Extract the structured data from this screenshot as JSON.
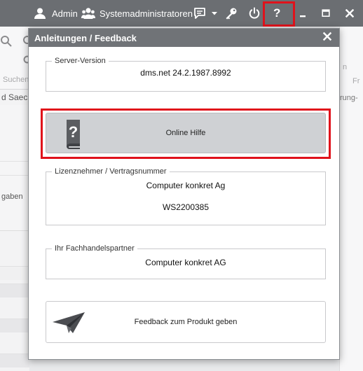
{
  "topbar": {
    "user_name": "Admin",
    "group_name": "Systemadministratoren",
    "help_glyph": "?",
    "icons": [
      "user-icon",
      "group-icon",
      "chat-icon",
      "dropdown-icon",
      "key-icon",
      "power-icon",
      "help-icon",
      "minimize-icon",
      "maximize-icon",
      "close-icon"
    ],
    "highlight_color": "#e0121b"
  },
  "background": {
    "ribbon_search_label": "Suchen",
    "path_text": "d Saeck",
    "row_text": "gaben",
    "right_text_1": "n",
    "right_text_2": "Fr",
    "right_text_3": "rung-"
  },
  "dialog": {
    "title": "Anleitungen / Feedback",
    "server": {
      "legend": "Server-Version",
      "value": "dms.net 24.2.1987.8992"
    },
    "online_help": {
      "label": "Online Hilfe",
      "icon": "help-book-icon"
    },
    "licensee": {
      "legend": "Lizenznehmer / Vertragsnummer",
      "company": "Computer konkret Ag",
      "contract": "WS2200385"
    },
    "partner": {
      "legend": "Ihr Fachhandelspartner",
      "value": "Computer konkret AG"
    },
    "feedback": {
      "label": "Feedback zum Produkt geben",
      "icon": "paper-plane-icon"
    }
  },
  "colors": {
    "titlebar": "#6b6e72",
    "dialog_header": "#707377",
    "highlight": "#e0121b",
    "help_button": "#cfd1d4"
  }
}
